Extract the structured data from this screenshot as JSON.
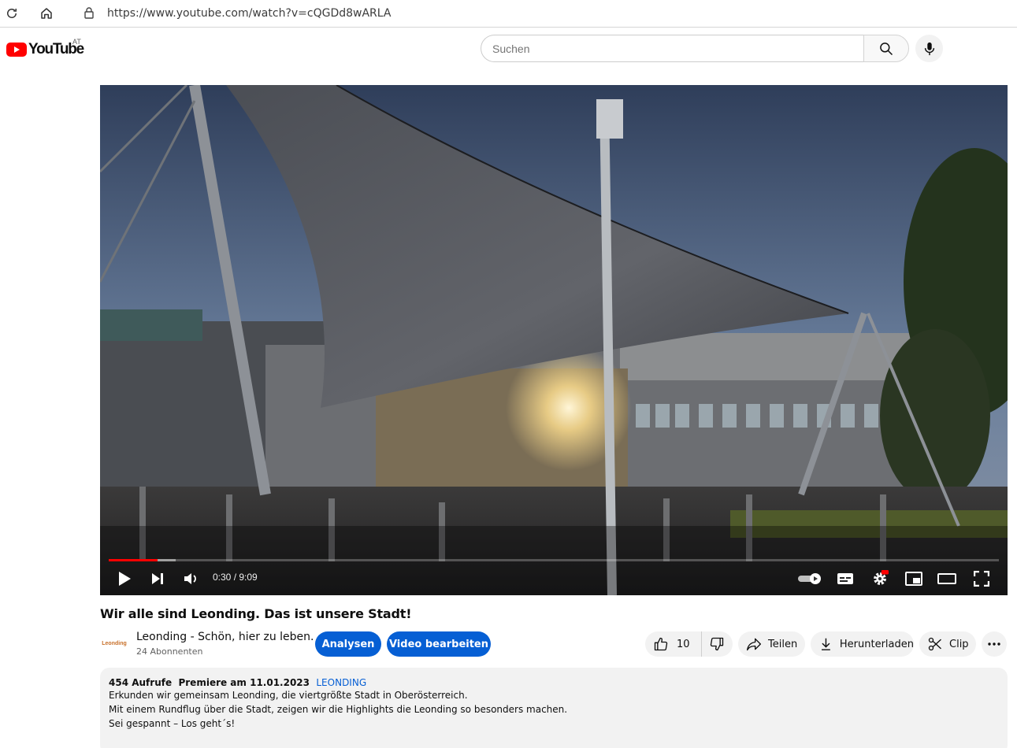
{
  "browser": {
    "url": "https://www.youtube.com/watch?v=cQGDd8wARLA"
  },
  "header": {
    "logo_text": "YouTube",
    "country": "AT",
    "search_placeholder": "Suchen"
  },
  "player": {
    "time": "0:30 / 9:09",
    "progress": 0.055,
    "buffered": 0.075,
    "colors": {
      "progress": "#ff0000",
      "hd_badge": "#ff0000"
    }
  },
  "video": {
    "title": "Wir alle sind Leonding. Das ist unsere Stadt!",
    "channel_name": "Leonding - Schön, hier zu leben.",
    "channel_logo_text": "Leonding",
    "subscribers": "24 Abonnenten",
    "analytics_label": "Analysen",
    "edit_label": "Video bearbeiten",
    "likes": "10",
    "share_label": "Teilen",
    "download_label": "Herunterladen",
    "clip_label": "Clip"
  },
  "description": {
    "views": "454 Aufrufe",
    "premiere": "Premiere am 11.01.2023",
    "hashtag": "LEONDING",
    "lines": [
      "Erkunden wir gemeinsam Leonding, die viertgrößte Stadt in Oberösterreich.",
      "Mit einem Rundflug über die Stadt, zeigen wir die Highlights die Leonding so besonders machen.",
      "Sei gespannt – Los geht´s!"
    ]
  },
  "colors": {
    "accent_blue": "#065fd4",
    "brand_red": "#ff0000"
  }
}
